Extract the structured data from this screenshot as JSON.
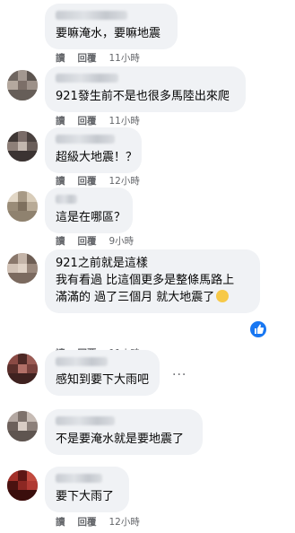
{
  "actions": {
    "reply": "讀",
    "reply2": "回覆"
  },
  "comments": [
    {
      "lines": [
        "要嘛淹水，要嘛地震"
      ],
      "time": "11小時"
    },
    {
      "lines": [
        "921發生前不是也很多馬陸出來爬"
      ],
      "time": "11小時"
    },
    {
      "lines": [
        "超級大地震！？"
      ],
      "time": "12小時"
    },
    {
      "lines": [
        "這是在哪區？"
      ],
      "time": "9小時"
    },
    {
      "lines": [
        "921之前就是這樣",
        "我有看過 比這個更多是整條馬路上",
        "滿滿的 過了三個月 就大地震了"
      ],
      "time": "11小時"
    },
    {
      "lines": [
        "感知到要下大雨吧"
      ],
      "time": ""
    },
    {
      "lines": [
        "不是要淹水就是要地震了"
      ],
      "time": ""
    },
    {
      "lines": [
        "要下大雨了"
      ],
      "time": "12小時"
    }
  ],
  "icons": {
    "more": "more-icon",
    "reaction": "like-reaction-icon",
    "emoji": "crying-face-emoji"
  },
  "colors": {
    "bubble": "#f0f2f5",
    "meta": "#65676b",
    "like": "#1877f2"
  }
}
